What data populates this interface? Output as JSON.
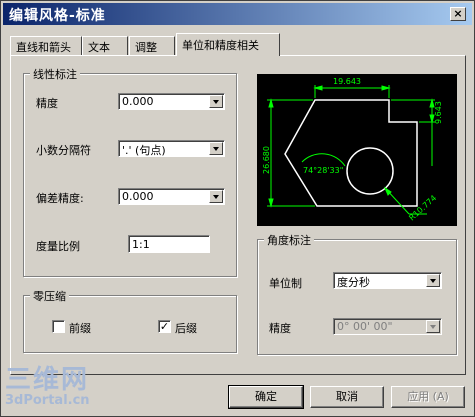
{
  "window": {
    "title": "编辑风格-标准",
    "close_glyph": "×"
  },
  "tabs": [
    {
      "label": "直线和箭头",
      "active": false
    },
    {
      "label": "文本",
      "active": false
    },
    {
      "label": "调整",
      "active": false
    },
    {
      "label": "单位和精度相关",
      "active": true
    }
  ],
  "linear": {
    "title": "线性标注",
    "precision_label": "精度",
    "precision_value": "0.000",
    "decimal_sep_label": "小数分隔符",
    "decimal_sep_value": "'.'  (句点)",
    "tolerance_label": "偏差精度:",
    "tolerance_value": "0.000",
    "scale_label": "度量比例",
    "scale_value": "1:1"
  },
  "zero_suppress": {
    "title": "零压缩",
    "leading_label": "前缀",
    "leading_checked": false,
    "trailing_label": "后缀",
    "trailing_checked": true,
    "check_glyph": "✓"
  },
  "preview": {
    "dim_top": "19.643",
    "dim_left": "26.680",
    "dim_right": "9.643",
    "dim_angle": "74°28'33\"",
    "dim_radius": "R10.774",
    "stroke_color": "#ffffff",
    "dim_color": "#00ff00"
  },
  "angular": {
    "title": "角度标注",
    "unit_label": "单位制",
    "unit_value": "度分秒",
    "precision_label": "精度",
    "precision_value": "0° 00' 00\""
  },
  "buttons": {
    "ok": "确定",
    "cancel": "取消",
    "apply": "应用 (A)"
  },
  "watermark": {
    "main": "三维网",
    "sub": "3dPortal.cn"
  }
}
